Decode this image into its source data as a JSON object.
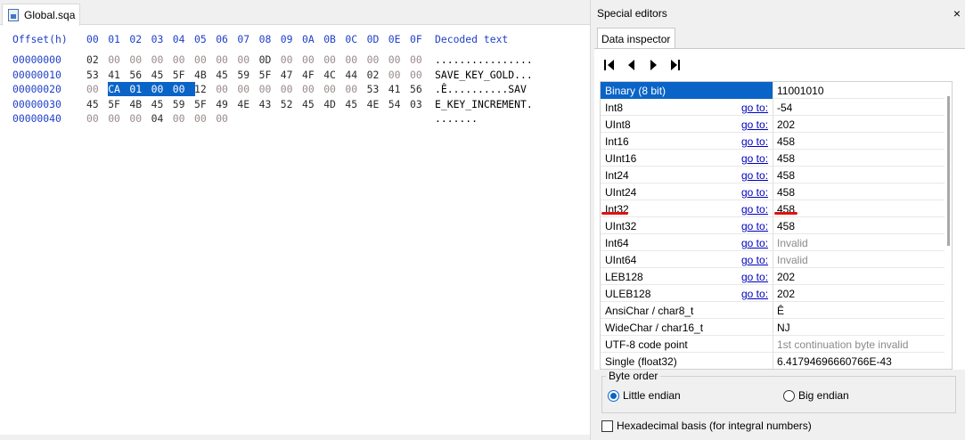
{
  "file_tab": {
    "label": "Global.sqa"
  },
  "hex_view": {
    "headers": [
      "Offset(h)",
      "00",
      "01",
      "02",
      "03",
      "04",
      "05",
      "06",
      "07",
      "08",
      "09",
      "0A",
      "0B",
      "0C",
      "0D",
      "0E",
      "0F",
      "Decoded text"
    ],
    "rows": [
      {
        "offset": "00000000",
        "bytes": [
          "02",
          "00",
          "00",
          "00",
          "00",
          "00",
          "00",
          "00",
          "0D",
          "00",
          "00",
          "00",
          "00",
          "00",
          "00",
          "00"
        ],
        "text": "................"
      },
      {
        "offset": "00000010",
        "bytes": [
          "53",
          "41",
          "56",
          "45",
          "5F",
          "4B",
          "45",
          "59",
          "5F",
          "47",
          "4F",
          "4C",
          "44",
          "02",
          "00",
          "00"
        ],
        "text": "SAVE_KEY_GOLD..."
      },
      {
        "offset": "00000020",
        "bytes": [
          "00",
          "CA",
          "01",
          "00",
          "00",
          "12",
          "00",
          "00",
          "00",
          "00",
          "00",
          "00",
          "00",
          "53",
          "41",
          "56"
        ],
        "text": ".Ê..........SAV"
      },
      {
        "offset": "00000030",
        "bytes": [
          "45",
          "5F",
          "4B",
          "45",
          "59",
          "5F",
          "49",
          "4E",
          "43",
          "52",
          "45",
          "4D",
          "45",
          "4E",
          "54",
          "03"
        ],
        "text": "E_KEY_INCREMENT."
      },
      {
        "offset": "00000040",
        "bytes": [
          "00",
          "00",
          "00",
          "04",
          "00",
          "00",
          "00"
        ],
        "text": "......."
      }
    ]
  },
  "special_editors": {
    "title": "Special editors",
    "close_icon": "×",
    "tab_label": "Data inspector",
    "goto_label": "go to:",
    "rows": [
      {
        "name": "Binary (8 bit)",
        "value": "11001010",
        "goto": false,
        "gray": false,
        "selected": true
      },
      {
        "name": "Int8",
        "value": "-54",
        "goto": true,
        "gray": false
      },
      {
        "name": "UInt8",
        "value": "202",
        "goto": true,
        "gray": false
      },
      {
        "name": "Int16",
        "value": "458",
        "goto": true,
        "gray": false
      },
      {
        "name": "UInt16",
        "value": "458",
        "goto": true,
        "gray": false
      },
      {
        "name": "Int24",
        "value": "458",
        "goto": true,
        "gray": false
      },
      {
        "name": "UInt24",
        "value": "458",
        "goto": true,
        "gray": false
      },
      {
        "name": "Int32",
        "value": "458",
        "goto": true,
        "gray": false,
        "underlined": true
      },
      {
        "name": "UInt32",
        "value": "458",
        "goto": true,
        "gray": false
      },
      {
        "name": "Int64",
        "value": "Invalid",
        "goto": true,
        "gray": true
      },
      {
        "name": "UInt64",
        "value": "Invalid",
        "goto": true,
        "gray": true
      },
      {
        "name": "LEB128",
        "value": "202",
        "goto": true,
        "gray": false
      },
      {
        "name": "ULEB128",
        "value": "202",
        "goto": true,
        "gray": false
      },
      {
        "name": "AnsiChar / char8_t",
        "value": "Ê",
        "goto": false,
        "gray": false
      },
      {
        "name": "WideChar / char16_t",
        "value": "NJ",
        "goto": false,
        "gray": false
      },
      {
        "name": "UTF-8 code point",
        "value": "1st continuation byte invalid",
        "goto": false,
        "gray": true
      },
      {
        "name": "Single (float32)",
        "value": "6.41794696660766E-43",
        "goto": false,
        "gray": false
      }
    ],
    "byte_order": {
      "label": "Byte order",
      "little": "Little endian",
      "big": "Big endian",
      "selected": "little"
    },
    "hex_basis": {
      "label": "Hexadecimal basis (for integral numbers)",
      "checked": false
    }
  },
  "colors": {
    "selection": "#0a64c8",
    "header_blue": "#1e3fc8",
    "annotation_red": "#e01010"
  }
}
